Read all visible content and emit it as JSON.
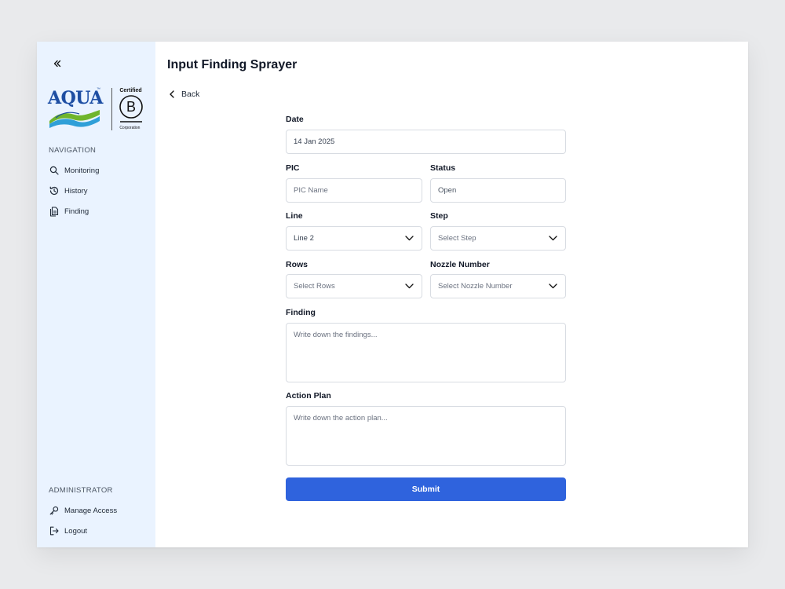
{
  "page": {
    "title": "Input Finding Sprayer"
  },
  "nav": {
    "back_label": "Back",
    "navigation_heading": "NAVIGATION",
    "items": [
      {
        "label": "Monitoring",
        "icon": "search-icon"
      },
      {
        "label": "History",
        "icon": "history-icon"
      },
      {
        "label": "Finding",
        "icon": "document-icon"
      }
    ],
    "admin_heading": "ADMINISTRATOR",
    "admin_items": [
      {
        "label": "Manage Access",
        "icon": "key-icon"
      },
      {
        "label": "Logout",
        "icon": "logout-icon"
      }
    ]
  },
  "logo": {
    "brand": "AQUA",
    "tm": "™",
    "bcorp_certified": "Certified",
    "bcorp_letter": "B",
    "bcorp_corporation": "Corporation"
  },
  "form": {
    "date": {
      "label": "Date",
      "value": "14 Jan 2025"
    },
    "pic": {
      "label": "PIC",
      "placeholder": "PIC Name"
    },
    "status": {
      "label": "Status",
      "value": "Open"
    },
    "line": {
      "label": "Line",
      "value": "Line 2"
    },
    "step": {
      "label": "Step",
      "placeholder": "Select Step"
    },
    "rows": {
      "label": "Rows",
      "placeholder": "Select Rows"
    },
    "nozzle": {
      "label": "Nozzle Number",
      "placeholder": "Select Nozzle Number"
    },
    "finding": {
      "label": "Finding",
      "placeholder": "Write down the findings..."
    },
    "action_plan": {
      "label": "Action Plan",
      "placeholder": "Write down the action plan..."
    },
    "submit_label": "Submit"
  },
  "colors": {
    "sidebar_bg": "#eaf3ff",
    "accent": "#2f63dd",
    "brand_blue": "#1f4ea1"
  }
}
